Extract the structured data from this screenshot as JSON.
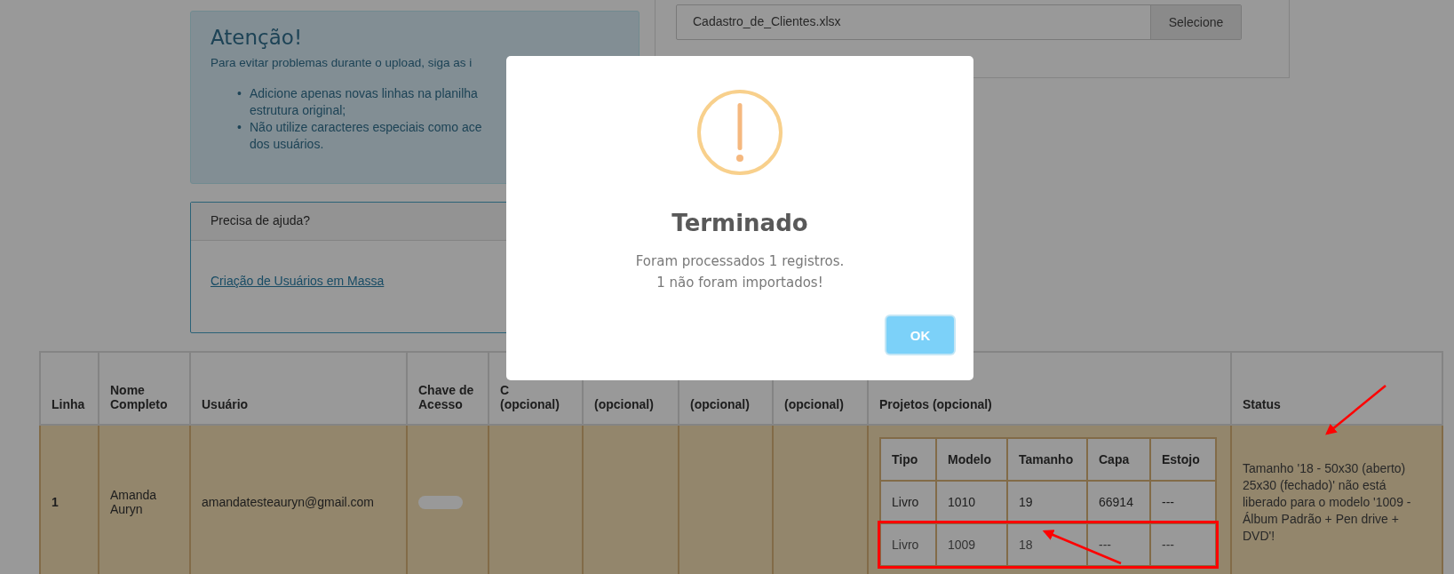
{
  "upload": {
    "file_name": "Cadastro_de_Clientes.xlsx",
    "button": "Selecione"
  },
  "alert": {
    "title": "Atenção!",
    "intro": "Para evitar problemas durante o upload, siga as i",
    "items": [
      {
        "bullet": "•",
        "lines": [
          "Adicione apenas novas linhas na planilha",
          "estrutura original;"
        ]
      },
      {
        "bullet": "•",
        "lines": [
          "Não utilize caracteres especiais como ace",
          "dos usuários."
        ]
      }
    ]
  },
  "help": {
    "title": "Precisa de ajuda?",
    "link": "Criação de Usuários em Massa"
  },
  "table": {
    "columns": [
      "Linha",
      "Nome Completo",
      "Usuário",
      "Chave de Acesso",
      "C\n(opcional)",
      "(opcional)",
      "(opcional)",
      "(opcional)",
      "Projetos (opcional)",
      "Status"
    ],
    "rows": [
      {
        "linha": "1",
        "nome": "Amanda Auryn",
        "usuario": "amandatesteauryn@gmail.com",
        "projetos": {
          "columns": [
            "Tipo",
            "Modelo",
            "Tamanho",
            "Capa",
            "Estojo"
          ],
          "rows": [
            {
              "cells": [
                "Livro",
                "1010",
                "19",
                "66914",
                "---"
              ],
              "highlighted": false
            },
            {
              "cells": [
                "Livro",
                "1009",
                "18",
                "---",
                "---"
              ],
              "highlighted": true
            }
          ]
        },
        "status": "Tamanho '18 - 50x30 (aberto) 25x30 (fechado)' não está liberado para o modelo '1009 - Álbum Padrão + Pen drive + DVD'!"
      }
    ]
  },
  "modal": {
    "title": "Terminado",
    "message": [
      "Foram processados 1 registros.",
      "1 não foram importados!"
    ],
    "button": "OK"
  }
}
